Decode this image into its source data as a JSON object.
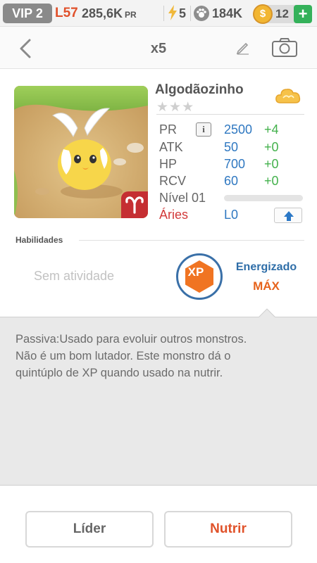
{
  "status_bar": {
    "vip": "VIP 2",
    "level": "L57",
    "power": "285,6K",
    "power_unit": "PR",
    "energy": "5",
    "paws": "184K",
    "coins": "12",
    "coin_symbol": "$",
    "add_label": "+"
  },
  "nav": {
    "title": "x5"
  },
  "monster": {
    "name": "Algodãozinho",
    "stars": "★★★",
    "stats": [
      {
        "label": "PR",
        "value": "2500",
        "bonus": "+4"
      },
      {
        "label": "ATK",
        "value": "50",
        "bonus": "+0"
      },
      {
        "label": "HP",
        "value": "700",
        "bonus": "+0"
      },
      {
        "label": "RCV",
        "value": "60",
        "bonus": "+0"
      }
    ],
    "info_label": "i",
    "level_label": "Nível 01",
    "level_progress": 0,
    "sign_label": "Áries",
    "sign_value": "L0"
  },
  "skills": {
    "title": "Habilidades",
    "no_activity": "Sem atividade",
    "xp_label": "XP",
    "energized_title": "Energizado",
    "energized_value": "MÁX"
  },
  "description": "Passiva:Usado para evoluir outros monstros. Não é um bom lutador. Este monstro dá o quintúplo de XP quando usado na nutrir.",
  "buttons": {
    "leader": "Líder",
    "feed": "Nutrir"
  },
  "colors": {
    "accent_orange": "#e0522a",
    "stat_blue": "#2f78c1",
    "bonus_green": "#43b14c",
    "sign_red": "#d23a3a"
  }
}
